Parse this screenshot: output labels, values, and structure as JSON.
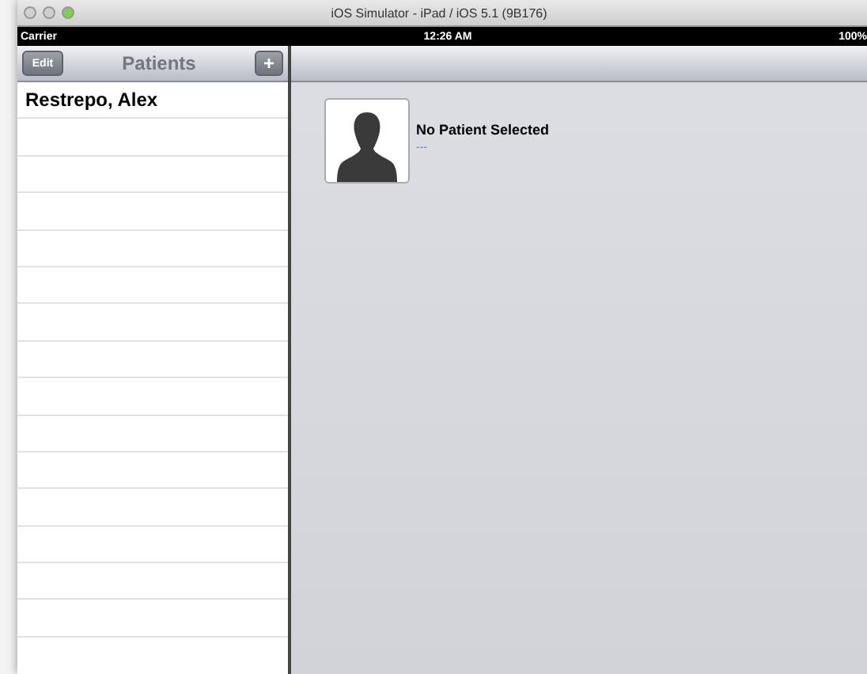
{
  "window": {
    "title": "iOS Simulator - iPad / iOS 5.1 (9B176)"
  },
  "status_bar": {
    "carrier": "Carrier",
    "time": "12:26 AM",
    "battery": "100%"
  },
  "master": {
    "title": "Patients",
    "edit_button": "Edit",
    "add_button": "+",
    "rows": [
      {
        "name": "Restrepo, Alex"
      }
    ]
  },
  "detail": {
    "title": "No Patient Selected",
    "subtitle": "---"
  }
}
